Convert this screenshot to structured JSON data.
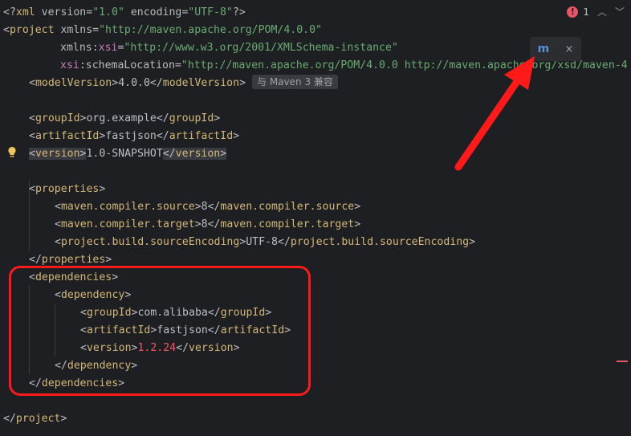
{
  "status": {
    "error_count": "1"
  },
  "hint": {
    "maven_compat": "与 Maven 3 兼容"
  },
  "popup": {
    "icon_label": "m",
    "close_label": "×"
  },
  "code": {
    "l1": {
      "a": "<?",
      "b": "xml",
      "c": " version=",
      "d": "\"1.0\"",
      "e": " encoding=",
      "f": "\"UTF-8\"",
      "g": "?>"
    },
    "l2": {
      "a": "<",
      "b": "project",
      "c": " xmlns=",
      "d": "\"http://maven.apache.org/POM/4.0.0\""
    },
    "l3": {
      "a": "xmlns",
      "b": ":",
      "c": "xsi",
      "d": "=",
      "e": "\"http://www.w3.org/2001/XMLSchema-instance\""
    },
    "l4": {
      "a": "xsi",
      "b": ":schemaLocation=",
      "c": "\"http://maven.apache.org/POM/4.0.0 http://maven.apache.org/xsd/maven-4"
    },
    "l5": {
      "a": "<",
      "b": "modelVersion",
      "c": ">",
      "d": "4.0.0",
      "e": "</",
      "f": "modelVersion",
      "g": ">"
    },
    "l7": {
      "a": "<",
      "b": "groupId",
      "c": ">",
      "d": "org.example",
      "e": "</",
      "f": "groupId",
      "g": ">"
    },
    "l8": {
      "a": "<",
      "b": "artifactId",
      "c": ">",
      "d": "fastjson",
      "e": "</",
      "f": "artifactId",
      "g": ">"
    },
    "l9": {
      "a": "<",
      "b": "version",
      "c": ">",
      "d": "1.0-SNAPSHOT",
      "e": "</",
      "f": "version",
      "g": ">"
    },
    "l11": {
      "a": "<",
      "b": "properties",
      "c": ">"
    },
    "l12": {
      "a": "<",
      "b": "maven.compiler.source",
      "c": ">",
      "d": "8",
      "e": "</",
      "f": "maven.compiler.source",
      "g": ">"
    },
    "l13": {
      "a": "<",
      "b": "maven.compiler.target",
      "c": ">",
      "d": "8",
      "e": "</",
      "f": "maven.compiler.target",
      "g": ">"
    },
    "l14": {
      "a": "<",
      "b": "project.build.sourceEncoding",
      "c": ">",
      "d": "UTF-8",
      "e": "</",
      "f": "project.build.sourceEncoding",
      "g": ">"
    },
    "l15": {
      "a": "</",
      "b": "properties",
      "c": ">"
    },
    "l16": {
      "a": "<",
      "b": "dependencies",
      "c": ">"
    },
    "l17": {
      "a": "<",
      "b": "dependency",
      "c": ">"
    },
    "l18": {
      "a": "<",
      "b": "groupId",
      "c": ">",
      "d": "com.alibaba",
      "e": "</",
      "f": "groupId",
      "g": ">"
    },
    "l19": {
      "a": "<",
      "b": "artifactId",
      "c": ">",
      "d": "fastjson",
      "e": "</",
      "f": "artifactId",
      "g": ">"
    },
    "l20": {
      "a": "<",
      "b": "version",
      "c": ">",
      "d": "1.2.24",
      "e": "</",
      "f": "version",
      "g": ">"
    },
    "l21": {
      "a": "</",
      "b": "dependency",
      "c": ">"
    },
    "l22": {
      "a": "</",
      "b": "dependencies",
      "c": ">"
    },
    "l24": {
      "a": "</",
      "b": "project",
      "c": ">"
    }
  },
  "colors": {
    "annotation": "#ff1a1a",
    "tag": "#d5b778",
    "string": "#6aab73"
  }
}
